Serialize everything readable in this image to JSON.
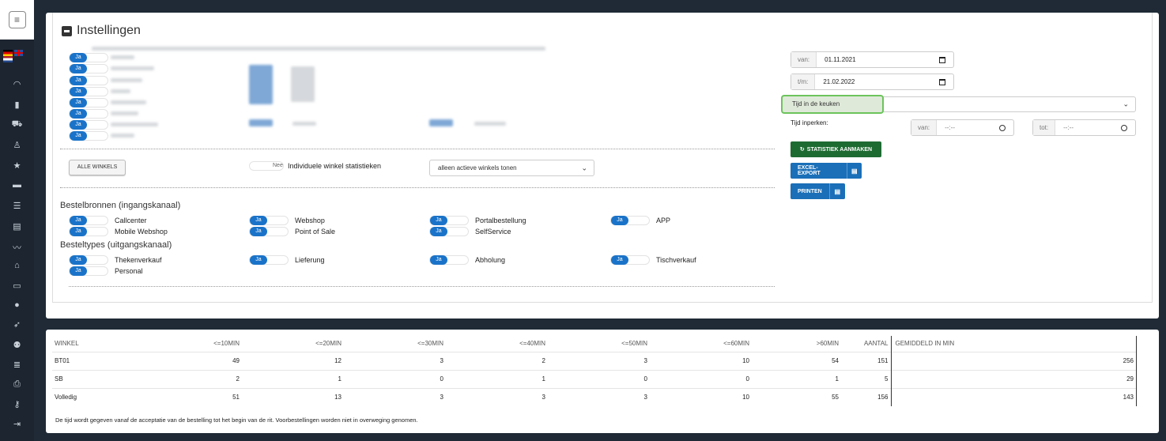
{
  "title": "Instellingen",
  "toggles_yes": "Ja",
  "toggles_no": "Nee",
  "all_stores_button": "ALLE WINKELS",
  "individual_store_stats": "Individuele winkel statistieken",
  "active_stores_select": "alleen actieve winkels tonen",
  "order_sources_title": "Bestelbronnen (ingangskanaal)",
  "order_sources": [
    "Callcenter",
    "Webshop",
    "Portalbestellung",
    "APP",
    "Mobile Webshop",
    "Point of Sale",
    "SelfService"
  ],
  "order_types_title": "Besteltypes (uitgangskanaal)",
  "order_types": [
    "Thekenverkauf",
    "Lieferung",
    "Abholung",
    "Tischverkauf",
    "Personal"
  ],
  "date_from_label": "van:",
  "date_from": "01.11.2021",
  "date_to_label": "t/m:",
  "date_to": "21.02.2022",
  "stat_type": "Tijd in de keuken",
  "time_limit_label": "Tijd inperken:",
  "time_from_label": "van:",
  "time_from": "--:--",
  "time_to_label": "tot:",
  "time_to": "--:--",
  "create_stats_button": "STATISTIEK AANMAKEN",
  "excel_export_button": "EXCEL-EXPORT",
  "print_button": "PRINTEN",
  "table": {
    "headers": [
      "WINKEL",
      "<=10MIN",
      "<=20MIN",
      "<=30MIN",
      "<=40MIN",
      "<=50MIN",
      "<=60MIN",
      ">60MIN",
      "AANTAL",
      "GEMIDDELD IN MIN"
    ],
    "rows": [
      [
        "BT01",
        "49",
        "12",
        "3",
        "2",
        "3",
        "10",
        "54",
        "151",
        "256"
      ],
      [
        "SB",
        "2",
        "1",
        "0",
        "1",
        "0",
        "0",
        "1",
        "5",
        "29"
      ],
      [
        "Volledig",
        "51",
        "13",
        "3",
        "3",
        "3",
        "10",
        "55",
        "156",
        "143"
      ]
    ]
  },
  "note": "De tijd wordt gegeven vanaf de acceptatie van de bestelling tot het begin van de rit. Voorbestellingen worden niet in overweging genomen.",
  "colors": {
    "primary": "#1a73c8",
    "success": "#1e7a3a",
    "highlight_border": "#6cc45c"
  }
}
